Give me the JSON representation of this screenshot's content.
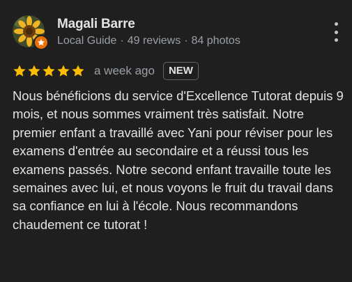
{
  "reviewer": {
    "name": "Magali Barre",
    "badge_label": "Local Guide",
    "reviews": "49 reviews",
    "photos": "84 photos",
    "separator": "·"
  },
  "review": {
    "rating": 5,
    "max_rating": 5,
    "time": "a week ago",
    "new_label": "NEW",
    "text": "Nous bénéficions du service d'Excellence Tutorat depuis 9 mois, et nous sommes vraiment très satisfait. Notre premier enfant a travaillé avec Yani pour réviser pour les examens d'entrée au secondaire et a réussi tous les examens passés. Notre second enfant travaille toute les semaines avec lui, et nous voyons le fruit du travail dans sa confiance en lui à l'école. Nous recommandons chaudement ce tutorat !"
  },
  "icons": {
    "avatar": "sunflower-avatar",
    "badge": "local-guide-star-icon",
    "more": "more-vert-icon",
    "star": "star-icon"
  },
  "colors": {
    "background": "#1f1f1f",
    "star": "#fbbc04",
    "guide_badge": "#e8710a",
    "secondary_text": "#9aa0a6",
    "primary_text": "#e3e3e3"
  }
}
